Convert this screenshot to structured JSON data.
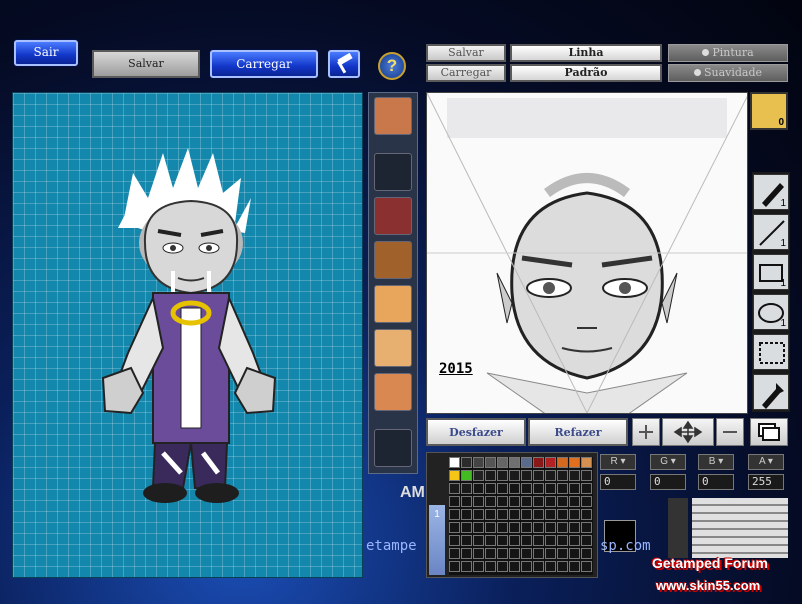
{
  "top_bar": {
    "exit_label": "Sair",
    "save_label": "Salvar",
    "load_label": "Carregar",
    "help_glyph": "?"
  },
  "right_toolbar": {
    "save_label": "Salvar",
    "load_label": "Carregar",
    "line_label": "Linha",
    "default_label": "Padrão",
    "paint_label": "Pintura",
    "smooth_label": "Suavidade"
  },
  "canvas": {
    "signature": "2015",
    "undo_label": "Desfazer",
    "redo_label": "Refazer"
  },
  "character_preview": {
    "partial_text": "AM",
    "url_fragment": "etampe"
  },
  "tools": {
    "pen_count": "1",
    "line_count": "1",
    "rect_count": "1",
    "ellipse_count": "1",
    "avatar_count": "0"
  },
  "color_values": {
    "r": "0",
    "g": "0",
    "b": "0",
    "a": "255",
    "r_label": "R",
    "g_label": "G",
    "b_label": "B",
    "a_label": "A"
  },
  "layer_strip": {
    "number": "1"
  },
  "watermark": {
    "line1": "Getamped Forum",
    "line2": "www.skin55.com",
    "url_tail": "sp.com"
  },
  "palette_colors": [
    "#ffffff",
    "#2b2b2b",
    "#444444",
    "#555555",
    "#666666",
    "#707070",
    "#5a6a8a",
    "#8a1818",
    "#b22222",
    "#d2691e",
    "#e07020",
    "#d49050",
    "#f5c518",
    "#44bb22",
    "#222222",
    "#1a1a1a",
    "#1a1a1a",
    "#1a1a1a",
    "#1a1a1a",
    "#1a1a1a",
    "#1a1a1a",
    "#1a1a1a",
    "#1a1a1a",
    "#1a1a1a",
    "#1a1a1a",
    "#1a1a1a"
  ]
}
